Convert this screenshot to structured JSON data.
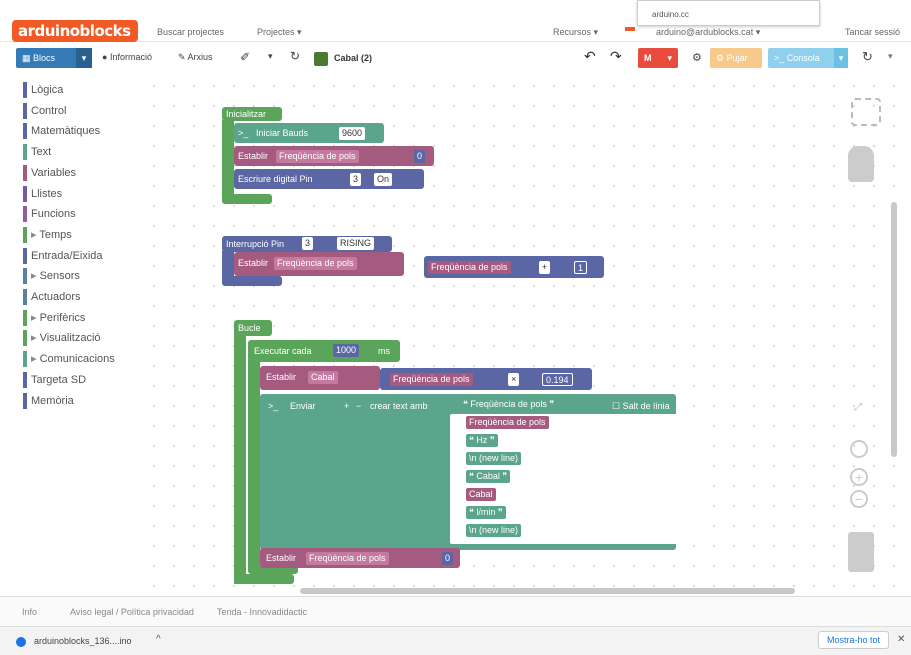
{
  "nav": {
    "logo": "arduinoblocks",
    "search": "Buscar projectes",
    "projects": "Projectes ▾",
    "resources": "Recursos ▾",
    "user_email": "arduino@ardublocks.cat ▾",
    "logout": "Tancar sessió",
    "tooltip": "arduino.cc"
  },
  "toolbar": {
    "blocs": "Blocs",
    "info": "Informació",
    "files": "Arxius",
    "project_title": "Cabal (2)",
    "upload": "Pujar",
    "console": "Consola"
  },
  "palette": [
    {
      "label": "Lògica",
      "color": "#5b67a5"
    },
    {
      "label": "Control",
      "color": "#5b67a5"
    },
    {
      "label": "Matemàtiques",
      "color": "#5b67a5"
    },
    {
      "label": "Text",
      "color": "#5ba58c"
    },
    {
      "label": "Variables",
      "color": "#a55b80"
    },
    {
      "label": "Llistes",
      "color": "#745ba5"
    },
    {
      "label": "Funcions",
      "color": "#9a5ba5"
    },
    {
      "label": "Temps",
      "color": "#5ba55b"
    },
    {
      "label": "Entrada/Eixida",
      "color": "#5b67a5"
    },
    {
      "label": "Sensors",
      "color": "#5b80a5"
    },
    {
      "label": "Actuadors",
      "color": "#5b80a5"
    },
    {
      "label": "Perifèrics",
      "color": "#5ba55b"
    },
    {
      "label": "Visualització",
      "color": "#5ba55b"
    },
    {
      "label": "Comunicacions",
      "color": "#5ba58c"
    },
    {
      "label": "Targeta SD",
      "color": "#5b67a5"
    },
    {
      "label": "Memòria",
      "color": "#5b67a5"
    }
  ],
  "blocks": {
    "init": "Inicialitzar",
    "init_serial": "Iniciar  Bauds",
    "baud": "9600",
    "set": "Establir",
    "var_freq": "Freqüència de pols",
    "zero": "0",
    "digital_write": "Escriure digital  Pin",
    "pin3": "3",
    "on": "On",
    "interrupt": "Interrupció  Pin",
    "rising": "RISING",
    "plus": "+",
    "one": "1",
    "loop": "Bucle",
    "every": "Executar cada",
    "ms_val": "1000",
    "ms": "ms",
    "var_cabal": "Cabal",
    "mult": "×",
    "factor": "0.194",
    "send": "Enviar",
    "create_text": "crear text amb",
    "newline_flag": "Salt de línia",
    "hz": "Hz",
    "newline": "\\n (new line)",
    "cabal_text": "Cabal",
    "lmin": "l/min"
  },
  "footer": {
    "info": "Info",
    "legal": "Aviso legal / Política privacidad",
    "shop": "Tenda - Innovadidactic"
  },
  "download": {
    "file": "arduinoblocks_136....ino",
    "show_all": "Mostra-ho tot"
  }
}
